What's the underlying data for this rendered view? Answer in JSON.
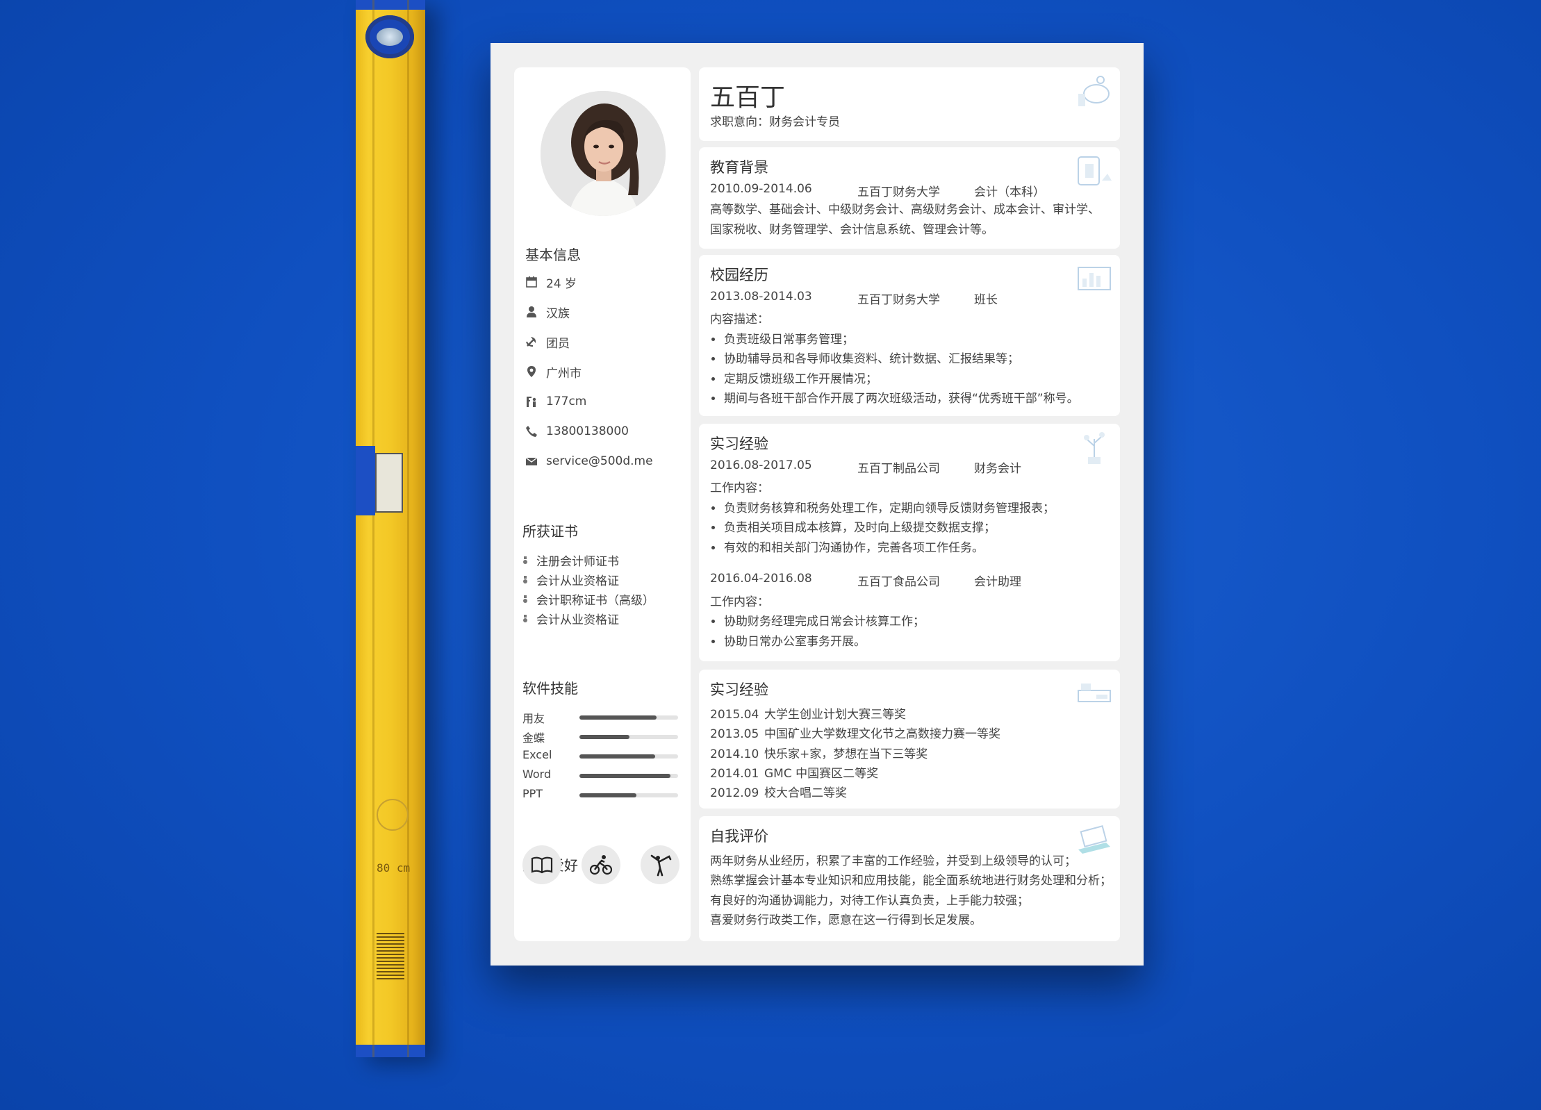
{
  "resume": {
    "name": "五百丁",
    "intent_label": "求职意向：",
    "intent": "财务会计专员",
    "basic_info": {
      "title": "基本信息",
      "items": [
        {
          "icon": "calendar-icon",
          "text": "24 岁"
        },
        {
          "icon": "person-icon",
          "text": "汉族"
        },
        {
          "icon": "party-icon",
          "text": "团员"
        },
        {
          "icon": "location-pin-icon",
          "text": "广州市"
        },
        {
          "icon": "height-icon",
          "text": "177cm"
        },
        {
          "icon": "phone-icon",
          "text": "13800138000"
        },
        {
          "icon": "mail-icon",
          "text": "service@500d.me"
        }
      ]
    },
    "certificates": {
      "title": "所获证书",
      "items": [
        "注册会计师证书",
        "会计从业资格证",
        "会计职称证书（高级）",
        "会计从业资格证"
      ]
    },
    "skills": {
      "title": "软件技能",
      "items": [
        {
          "name": "用友",
          "level": 0.78
        },
        {
          "name": "金蝶",
          "level": 0.51
        },
        {
          "name": "Excel",
          "level": 0.77
        },
        {
          "name": "Word",
          "level": 0.92
        },
        {
          "name": "PPT",
          "level": 0.58
        }
      ]
    },
    "hobbies": {
      "title": "兴趣爱好",
      "items": [
        "book-icon",
        "cycling-icon",
        "yoga-icon"
      ]
    },
    "education": {
      "title": "教育背景",
      "date": "2010.09-2014.06",
      "school": "五百丁财务大学",
      "major": "会计（本科）",
      "courses": "高等数学、基础会计、中级财务会计、高级财务会计、成本会计、审计学、国家税收、财务管理学、会计信息系统、管理会计等。"
    },
    "campus": {
      "title": "校园经历",
      "date": "2013.08-2014.03",
      "org": "五百丁财务大学",
      "role": "班长",
      "desc_label": "内容描述：",
      "bullets": [
        "负责班级日常事务管理；",
        "协助辅导员和各导师收集资料、统计数据、汇报结果等；",
        "定期反馈班级工作开展情况；",
        "期间与各班干部合作开展了两次班级活动，获得“优秀班干部”称号。"
      ]
    },
    "internship": {
      "title": "实习经验",
      "jobs": [
        {
          "date": "2016.08-2017.05",
          "company": "五百丁制品公司",
          "role": "财务会计",
          "label": "工作内容：",
          "bullets": [
            "负责财务核算和税务处理工作，定期向领导反馈财务管理报表；",
            "负责相关项目成本核算，及时向上级提交数据支撑；",
            "有效的和相关部门沟通协作，完善各项工作任务。"
          ]
        },
        {
          "date": "2016.04-2016.08",
          "company": "五百丁食品公司",
          "role": "会计助理",
          "label": "工作内容：",
          "bullets": [
            "协助财务经理完成日常会计核算工作；",
            "协助日常办公室事务开展。"
          ]
        }
      ]
    },
    "awards": {
      "title": "实习经验",
      "items": [
        {
          "date": "2015.04",
          "text": "大学生创业计划大赛三等奖"
        },
        {
          "date": "2013.05",
          "text": "中国矿业大学数理文化节之高数接力赛一等奖"
        },
        {
          "date": "2014.10",
          "text": "快乐家+家，梦想在当下三等奖"
        },
        {
          "date": "2014.01",
          "text": "GMC 中国赛区二等奖"
        },
        {
          "date": "2012.09",
          "text": "校大合唱二等奖"
        }
      ]
    },
    "self_eval": {
      "title": "自我评价",
      "lines": [
        "两年财务从业经历，积累了丰富的工作经验，并受到上级领导的认可；",
        "熟练掌握会计基本专业知识和应用技能，能全面系统地进行财务处理和分析；",
        "有良好的沟通协调能力，对待工作认真负责，上手能力较强；",
        "喜爱财务行政类工作，愿意在这一行得到长足发展。"
      ]
    }
  },
  "level_tool": {
    "marking": "80 cm"
  },
  "colors": {
    "background": "#0f4fbf",
    "level_yellow": "#f3c826",
    "sheet": "#f0f0f0",
    "skill_fill": "#555555"
  }
}
